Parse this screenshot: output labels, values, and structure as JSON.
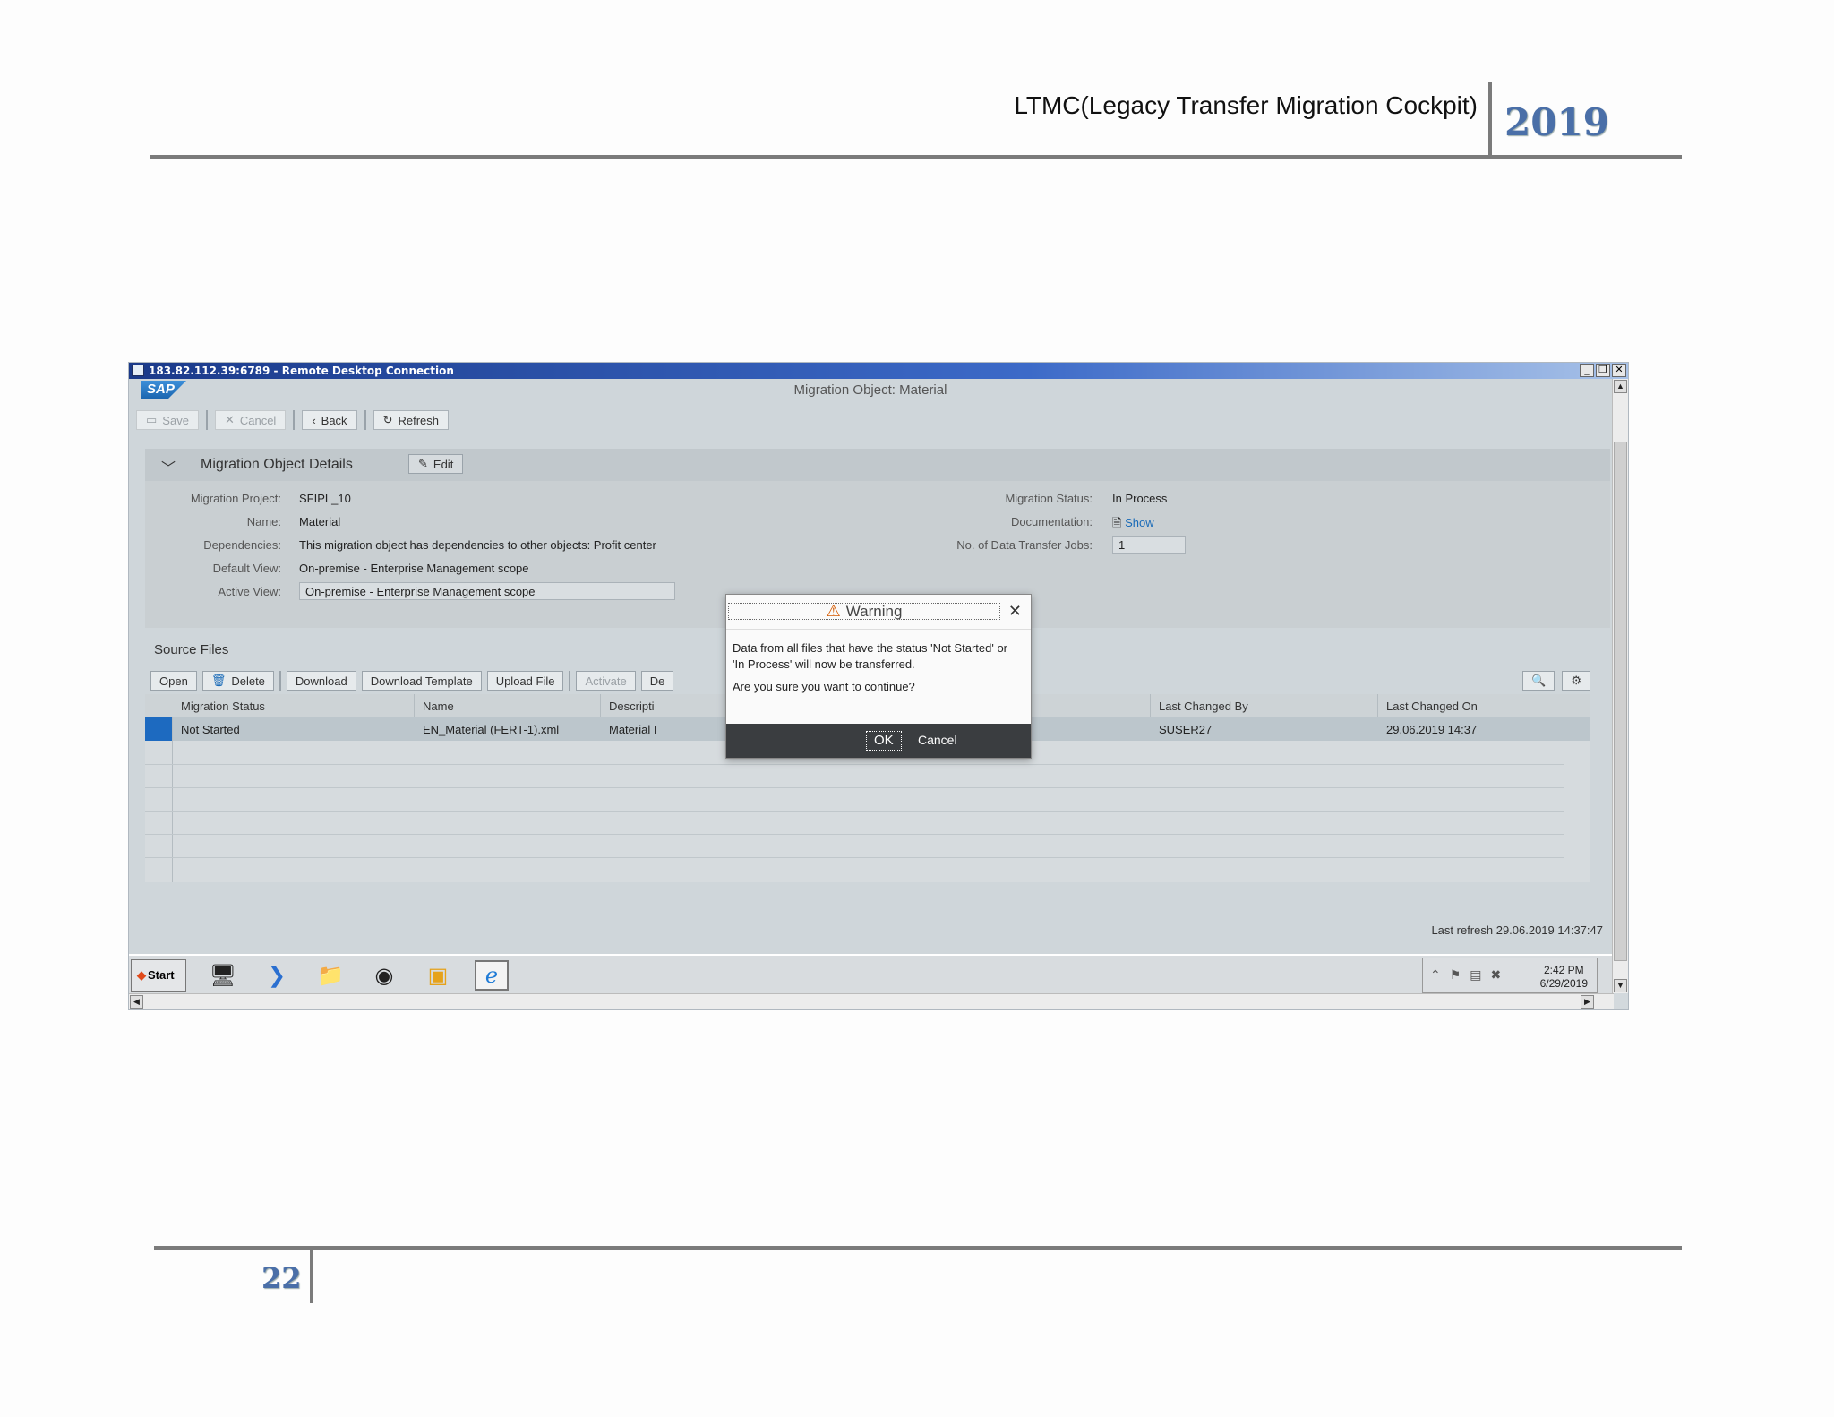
{
  "document": {
    "header_title": "LTMC(Legacy Transfer Migration Cockpit)",
    "header_year": "2019",
    "page_number": "22"
  },
  "window": {
    "title": "183.82.112.39:6789 - Remote Desktop Connection",
    "minimize": "_",
    "restore": "❐",
    "close": "✕"
  },
  "app": {
    "logo": "SAP",
    "title": "Migration Object: Material",
    "toolbar": {
      "save": "Save",
      "cancel": "Cancel",
      "back": "Back",
      "refresh": "Refresh"
    }
  },
  "details": {
    "title": "Migration Object Details",
    "edit": "Edit",
    "fields": {
      "migration_project_label": "Migration Project:",
      "migration_project": "SFIPL_10",
      "name_label": "Name:",
      "name": "Material",
      "dependencies_label": "Dependencies:",
      "dependencies": "This migration object has dependencies to other objects: Profit center",
      "default_view_label": "Default View:",
      "default_view": "On-premise - Enterprise Management scope",
      "active_view_label": "Active View:",
      "active_view": "On-premise - Enterprise Management scope",
      "migration_status_label": "Migration Status:",
      "migration_status": "In Process",
      "documentation_label": "Documentation:",
      "documentation": "Show",
      "jobs_label": "No. of Data Transfer Jobs:",
      "jobs": "1"
    }
  },
  "source_files": {
    "title": "Source Files",
    "buttons": {
      "open": "Open",
      "delete": "Delete",
      "download": "Download",
      "download_template": "Download Template",
      "upload_file": "Upload File",
      "activate": "Activate",
      "de": "De"
    },
    "columns": {
      "status": "Migration Status",
      "name": "Name",
      "description": "Descripti",
      "changed_by": "Last Changed By",
      "changed_on": "Last Changed On"
    },
    "row": {
      "status": "Not Started",
      "name": "EN_Material (FERT-1).xml",
      "description": "Material I",
      "changed_by": "SUSER27",
      "changed_on": "29.06.2019 14:37"
    },
    "last_refresh": "Last refresh 29.06.2019 14:37:47"
  },
  "dialog": {
    "title": "Warning",
    "message": "Data from all files that have the status 'Not Started' or 'In Process' will now be transferred.",
    "question": "Are you sure you want to continue?",
    "ok": "OK",
    "cancel": "Cancel"
  },
  "taskbar": {
    "start": "Start",
    "time": "2:42 PM",
    "date": "6/29/2019"
  }
}
